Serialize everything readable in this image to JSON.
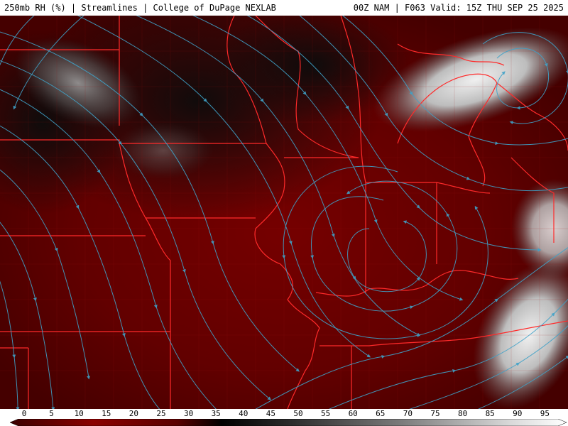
{
  "header": {
    "title": "250mb RH (%) | Streamlines | College of DuPage NEXLAB",
    "run_info": "00Z NAM | F063 Valid: 15Z THU SEP 25 2025"
  },
  "legend": {
    "ticks": [
      "0",
      "5",
      "10",
      "15",
      "20",
      "25",
      "30",
      "35",
      "40",
      "45",
      "50",
      "55",
      "60",
      "65",
      "70",
      "75",
      "80",
      "85",
      "90",
      "95"
    ]
  },
  "colors": {
    "dry": "#8b0000",
    "streamline": "#3fa2c8",
    "border": "#ff2a2a",
    "moist": "#d9d9d9"
  }
}
